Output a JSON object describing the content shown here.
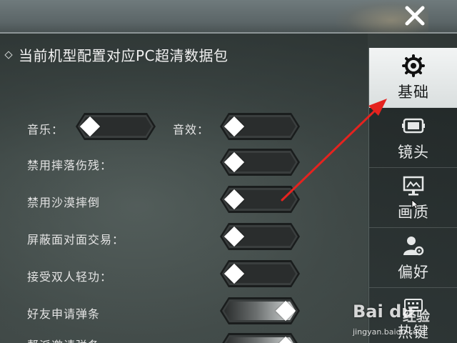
{
  "close_button": {
    "icon": "close-icon"
  },
  "settings": {
    "section_title": "当前机型配置对应PC超清数据包",
    "rows": [
      {
        "label": "音乐：",
        "on": false
      },
      {
        "label": "音效：",
        "on": false
      },
      {
        "label": "禁用摔落伤残：",
        "on": false
      },
      {
        "label": "禁用沙漠摔倒",
        "on": false
      },
      {
        "label": "屏蔽面对面交易：",
        "on": false
      },
      {
        "label": "接受双人轻功：",
        "on": false
      },
      {
        "label": "好友申请弹条",
        "on": true
      },
      {
        "label": "帮派邀请弹条",
        "on": true
      }
    ]
  },
  "side_nav": {
    "items": [
      {
        "label": "基础",
        "icon": "gear-icon",
        "active": true
      },
      {
        "label": "镜头",
        "icon": "camera-screen-icon",
        "active": false
      },
      {
        "label": "画质",
        "icon": "monitor-icon",
        "active": false
      },
      {
        "label": "偏好",
        "icon": "user-settings-icon",
        "active": false
      },
      {
        "label": "热键",
        "icon": "keyboard-icon",
        "active": false
      }
    ]
  },
  "annotation": {
    "color": "#e5231f"
  },
  "watermark": {
    "logo": "Bai du",
    "logo_cn": "经验",
    "url": "jingyan.baidu.com"
  },
  "colors": {
    "active_nav_bg": "#eef1f1",
    "toggle_knob": "#ffffff",
    "arrow": "#e5231f"
  }
}
